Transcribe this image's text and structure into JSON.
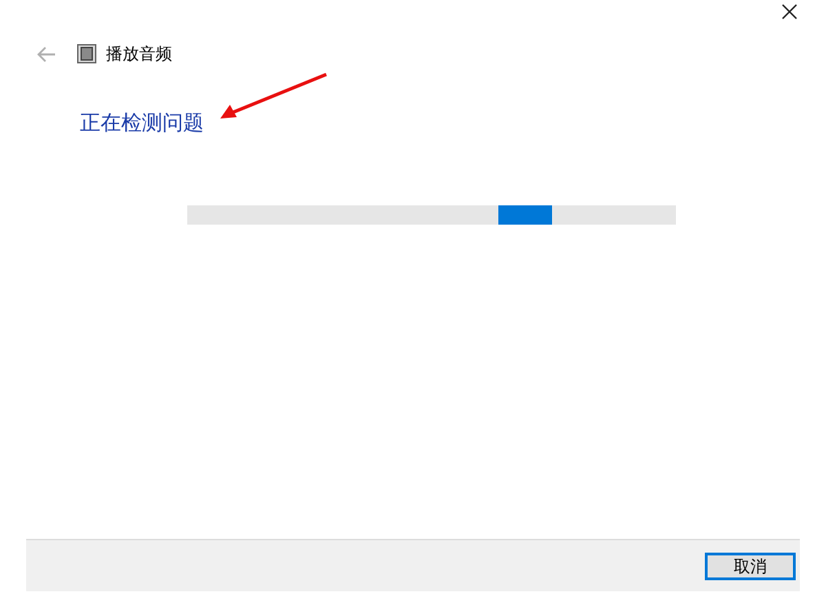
{
  "window": {
    "title": "播放音频"
  },
  "heading": "正在检测问题",
  "buttons": [
    {
      "label": "取消",
      "focused": true
    }
  ]
}
